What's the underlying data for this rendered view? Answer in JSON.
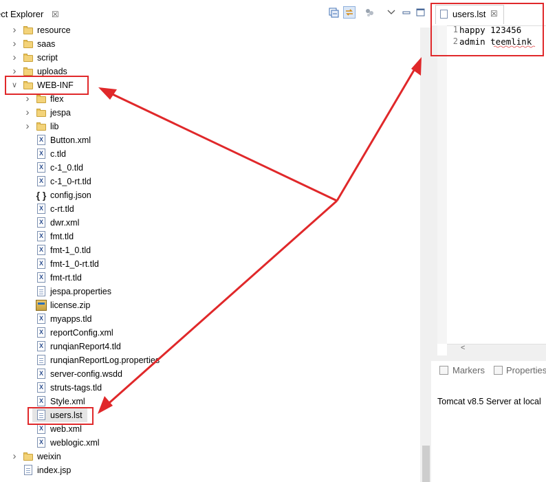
{
  "explorer": {
    "title": "ect Explorer",
    "close_glyph": "☒",
    "toolbar": [
      "collapse-all-icon",
      "link-with-editor-icon",
      "filters-icon",
      "view-menu-icon",
      "minimize-icon",
      "maximize-icon"
    ],
    "items": [
      {
        "label": "resource",
        "icon": "folder-icon",
        "expand": "collapsed"
      },
      {
        "label": "saas",
        "icon": "folder-icon",
        "expand": "collapsed"
      },
      {
        "label": "script",
        "icon": "folder-icon",
        "expand": "collapsed"
      },
      {
        "label": "uploads",
        "icon": "folder-icon",
        "expand": "collapsed"
      },
      {
        "label": "WEB-INF",
        "icon": "folder-icon",
        "expand": "expanded"
      },
      {
        "label": "flex",
        "icon": "folder-icon",
        "expand": "collapsed"
      },
      {
        "label": "jespa",
        "icon": "folder-icon",
        "expand": "collapsed"
      },
      {
        "label": "lib",
        "icon": "folder-icon",
        "expand": "collapsed"
      },
      {
        "label": "Button.xml",
        "icon": "xml-file-icon"
      },
      {
        "label": "c.tld",
        "icon": "xml-file-icon"
      },
      {
        "label": "c-1_0.tld",
        "icon": "xml-file-icon"
      },
      {
        "label": "c-1_0-rt.tld",
        "icon": "xml-file-icon"
      },
      {
        "label": "config.json",
        "icon": "json-file-icon"
      },
      {
        "label": "c-rt.tld",
        "icon": "xml-file-icon"
      },
      {
        "label": "dwr.xml",
        "icon": "xml-file-icon"
      },
      {
        "label": "fmt.tld",
        "icon": "xml-file-icon"
      },
      {
        "label": "fmt-1_0.tld",
        "icon": "xml-file-icon"
      },
      {
        "label": "fmt-1_0-rt.tld",
        "icon": "xml-file-icon"
      },
      {
        "label": "fmt-rt.tld",
        "icon": "xml-file-icon"
      },
      {
        "label": "jespa.properties",
        "icon": "text-file-icon"
      },
      {
        "label": "license.zip",
        "icon": "zip-file-icon"
      },
      {
        "label": "myapps.tld",
        "icon": "xml-file-icon"
      },
      {
        "label": "reportConfig.xml",
        "icon": "xml-file-icon"
      },
      {
        "label": "runqianReport4.tld",
        "icon": "xml-file-icon"
      },
      {
        "label": "runqianReportLog.properties",
        "icon": "text-file-icon"
      },
      {
        "label": "server-config.wsdd",
        "icon": "xml-file-icon"
      },
      {
        "label": "struts-tags.tld",
        "icon": "xml-file-icon"
      },
      {
        "label": "Style.xml",
        "icon": "xml-file-icon"
      },
      {
        "label": "users.lst",
        "icon": "text-file-icon",
        "selected": true
      },
      {
        "label": "web.xml",
        "icon": "xml-file-icon"
      },
      {
        "label": "weblogic.xml",
        "icon": "xml-file-icon"
      },
      {
        "label": "weixin",
        "icon": "folder-icon",
        "expand": "collapsed"
      },
      {
        "label": "index.jsp",
        "icon": "text-file-icon"
      }
    ]
  },
  "editor": {
    "tab_label": "users.lst",
    "close_glyph": "☒",
    "lines": [
      {
        "num": "1",
        "text": "happy 123456"
      },
      {
        "num": "2",
        "text": "admin teemlink"
      }
    ],
    "scroll_left_glyph": "<"
  },
  "panel": {
    "tabs": [
      {
        "label": "Markers",
        "icon": "markers-icon"
      },
      {
        "label": "Properties",
        "icon": "properties-icon"
      }
    ],
    "server_row": "Tomcat v8.5 Server at local"
  },
  "colors": {
    "annotation_red": "#e0282a",
    "folder": "#f3d37a",
    "selection": "#e5e5e5"
  }
}
